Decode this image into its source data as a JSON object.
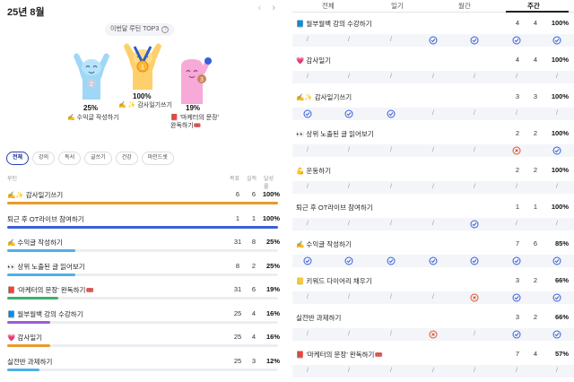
{
  "header": {
    "month": "25년 8월",
    "prev_icon": "‹",
    "next_icon": "›"
  },
  "top3": {
    "label": "이번달 루틴 TOP3",
    "info_icon": "?",
    "first": {
      "rank": "1",
      "pct": "100%",
      "name": "✍️ ✨ 감사일기쓰기"
    },
    "second": {
      "rank": "2",
      "pct": "25%",
      "name": "✍️ 수익글 작성하기"
    },
    "third": {
      "rank": "3",
      "pct": "19%",
      "name": "📕 '마케터의 문장' 완독하기🎟️"
    }
  },
  "tabs": [
    "전체",
    "강의",
    "독서",
    "글쓰기",
    "건강",
    "마인드셋"
  ],
  "table_head": {
    "routine": "루틴",
    "goal": "목표",
    "done": "실적",
    "rate": "달성률"
  },
  "routines": [
    {
      "name": "✍️✨ 감사일기쓰기",
      "goal": "6",
      "done": "6",
      "rate": "100%",
      "fill": 1.0,
      "color": "#e89a2c"
    },
    {
      "name": "퇴근 후 OT라이브 참여하기",
      "goal": "1",
      "done": "1",
      "rate": "100%",
      "fill": 1.0,
      "color": "#3a5fd6"
    },
    {
      "name": "✍️ 수익글 작성하기",
      "goal": "31",
      "done": "8",
      "rate": "25%",
      "fill": 0.25,
      "color": "#4fb0e6"
    },
    {
      "name": "👀 상위 노출된 글 읽어보기",
      "goal": "8",
      "done": "2",
      "rate": "25%",
      "fill": 0.25,
      "color": "#4fb0e6"
    },
    {
      "name": "📕 '마케터의 문장' 완독하기🎟️",
      "goal": "31",
      "done": "6",
      "rate": "19%",
      "fill": 0.19,
      "color": "#3bb26b"
    },
    {
      "name": "📘 월부월백 강의 수강하기",
      "goal": "25",
      "done": "4",
      "rate": "16%",
      "fill": 0.16,
      "color": "#9c5bd6"
    },
    {
      "name": "💗 감사일기",
      "goal": "25",
      "done": "4",
      "rate": "16%",
      "fill": 0.16,
      "color": "#e89a2c"
    },
    {
      "name": "실전반 과제하기",
      "goal": "25",
      "done": "3",
      "rate": "12%",
      "fill": 0.12,
      "color": "#4fb0e6"
    }
  ],
  "right_tabs": [
    "전체",
    "일기",
    "월간",
    "주간"
  ],
  "habits": [
    {
      "name": "📘 월부월백 강의 수강하기",
      "goal": "4",
      "done": "4",
      "rate": "100%",
      "days": [
        "/",
        "/",
        "/",
        "o",
        "o",
        "o",
        "o"
      ]
    },
    {
      "name": "💗 감사일기",
      "goal": "4",
      "done": "4",
      "rate": "100%",
      "days": [
        "/",
        "/",
        "/",
        "/",
        "/",
        "/",
        "/"
      ]
    },
    {
      "name": "✍️✨ 감사일기쓰기",
      "goal": "3",
      "done": "3",
      "rate": "100%",
      "days": [
        "o",
        "o",
        "o",
        "/",
        "/",
        "/",
        "/"
      ]
    },
    {
      "name": "👀 상위 노출된 글 읽어보기",
      "goal": "2",
      "done": "2",
      "rate": "100%",
      "days": [
        "/",
        "/",
        "/",
        "/",
        "/",
        "x",
        "o"
      ]
    },
    {
      "name": "💪 운동하기",
      "goal": "2",
      "done": "2",
      "rate": "100%",
      "days": [
        "/",
        "/",
        "/",
        "/",
        "/",
        "/",
        "/"
      ]
    },
    {
      "name": "퇴근 후 OT라이브 참여하기",
      "goal": "1",
      "done": "1",
      "rate": "100%",
      "days": [
        "/",
        "/",
        "/",
        "/",
        "o",
        "/",
        "/"
      ]
    },
    {
      "name": "✍️ 수익글 작성하기",
      "goal": "7",
      "done": "6",
      "rate": "85%",
      "days": [
        "o",
        "o",
        "o",
        "o",
        "o",
        "o",
        "o"
      ]
    },
    {
      "name": "📒 키워드 다이어리 채우기",
      "goal": "3",
      "done": "2",
      "rate": "66%",
      "days": [
        "/",
        "/",
        "/",
        "/",
        "x",
        "o",
        "o"
      ]
    },
    {
      "name": "실전반 과제하기",
      "goal": "3",
      "done": "2",
      "rate": "66%",
      "days": [
        "/",
        "/",
        "/",
        "x",
        "/",
        "o",
        "o"
      ]
    },
    {
      "name": "📕 '마케터의 문장' 완독하기🎟️",
      "goal": "7",
      "done": "4",
      "rate": "57%",
      "days": [
        "/",
        "/",
        "/",
        "/",
        "/",
        "/",
        "/"
      ]
    }
  ],
  "colors": {
    "accent": "#2a3eb1",
    "done": "#3a5fd6",
    "missed": "#e0522d",
    "empty": "#999999"
  }
}
